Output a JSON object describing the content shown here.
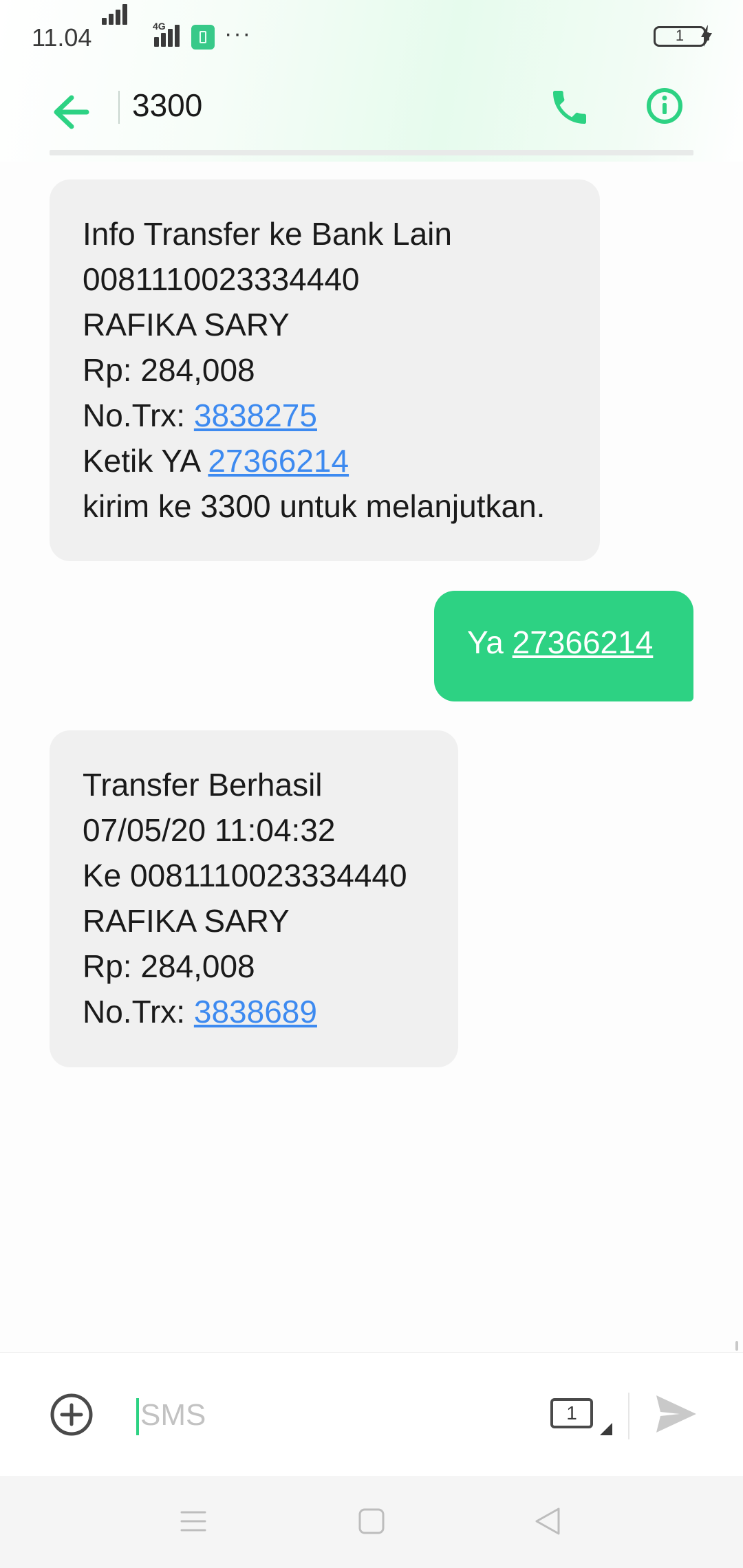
{
  "status_bar": {
    "time": "11.04",
    "network_label": "4G",
    "more_indicator": "···",
    "battery_text": "1",
    "icons": [
      "signal-icon",
      "signal-4g-icon",
      "sim-app-icon",
      "battery-icon",
      "charging-bolt-icon"
    ]
  },
  "header": {
    "title": "3300",
    "back_icon": "arrow-left-icon",
    "call_icon": "phone-icon",
    "info_icon": "info-circle-icon",
    "accent_color": "#2dd283"
  },
  "messages": [
    {
      "direction": "incoming",
      "lines": [
        {
          "text": "Info Transfer ke Bank Lain"
        },
        {
          "text": "0081110023334440"
        },
        {
          "text": "RAFIKA SARY"
        },
        {
          "text": "Rp: 284,008"
        },
        {
          "text": "No.Trx: ",
          "link": "3838275"
        },
        {
          "text": "Ketik YA ",
          "link": "27366214"
        },
        {
          "text": "kirim ke 3300 untuk melanjutkan."
        }
      ]
    },
    {
      "direction": "outgoing",
      "lines": [
        {
          "text": "Ya ",
          "link": "27366214"
        }
      ]
    },
    {
      "direction": "incoming",
      "lines": [
        {
          "text": "Transfer Berhasil"
        },
        {
          "text": "07/05/20 11:04:32"
        },
        {
          "text": "Ke 0081110023334440"
        },
        {
          "text": "RAFIKA SARY"
        },
        {
          "text": "Rp: 284,008"
        },
        {
          "text": "No.Trx: ",
          "link": "3838689"
        }
      ]
    }
  ],
  "composer": {
    "placeholder": "SMS",
    "value": "",
    "sim_slot": "1",
    "add_icon": "plus-circle-icon",
    "send_icon": "send-icon"
  },
  "nav_bar": {
    "icons": [
      "menu-icon",
      "home-square-icon",
      "back-triangle-icon"
    ]
  },
  "colors": {
    "incoming_bubble": "#f0f0f0",
    "outgoing_bubble": "#2dd283",
    "link": "#3d8af0"
  }
}
